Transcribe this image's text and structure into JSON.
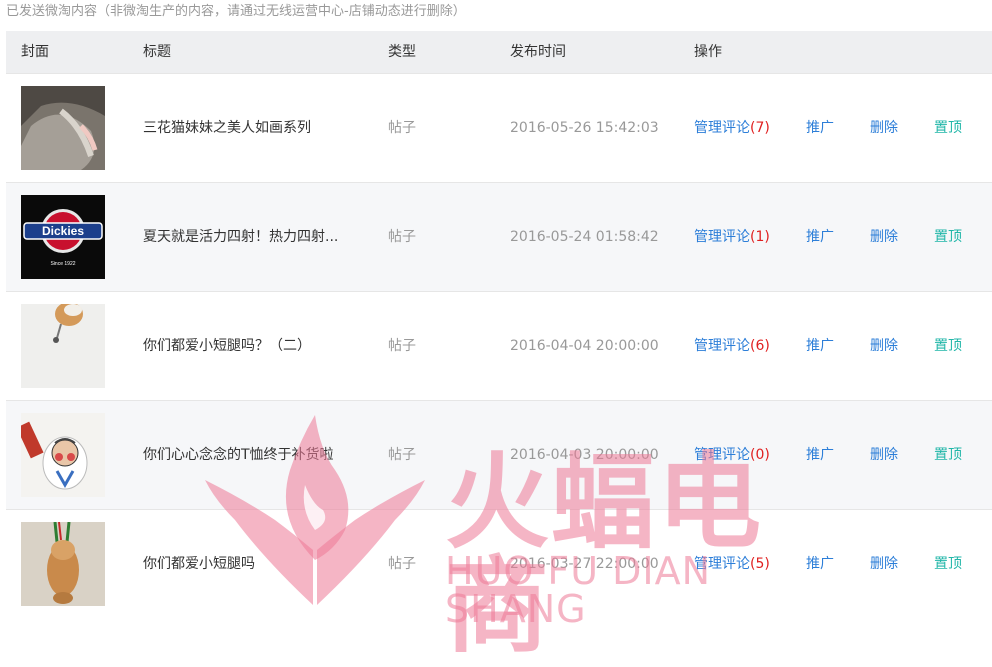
{
  "notice": "已发送微淘内容（非微淘生产的内容，请通过无线运营中心-店铺动态进行删除）",
  "columns": {
    "cover": "封面",
    "title": "标题",
    "type": "类型",
    "time": "发布时间",
    "actions": "操作"
  },
  "rows": [
    {
      "title": "三花猫妹妹之美人如画系列",
      "type": "帖子",
      "time": "2016-05-26 15:42:03",
      "manage": "管理评论",
      "count": "(7)",
      "promote": "推广",
      "delete": "删除",
      "pin": "置顶"
    },
    {
      "title": "夏天就是活力四射！热力四射...",
      "type": "帖子",
      "time": "2016-05-24 01:58:42",
      "manage": "管理评论",
      "count": "(1)",
      "promote": "推广",
      "delete": "删除",
      "pin": "置顶"
    },
    {
      "title": "你们都爱小短腿吗？（二）",
      "type": "帖子",
      "time": "2016-04-04 20:00:00",
      "manage": "管理评论",
      "count": "(6)",
      "promote": "推广",
      "delete": "删除",
      "pin": "置顶"
    },
    {
      "title": "你们心心念念的T恤终于补货啦",
      "type": "帖子",
      "time": "2016-04-03 20:00:00",
      "manage": "管理评论",
      "count": "(0)",
      "promote": "推广",
      "delete": "删除",
      "pin": "置顶"
    },
    {
      "title": "你们都爱小短腿吗",
      "type": "帖子",
      "time": "2016-03-27 22:00:00",
      "manage": "管理评论",
      "count": "(5)",
      "promote": "推广",
      "delete": "删除",
      "pin": "置顶"
    }
  ],
  "thumb_brand_text": "Dickies",
  "thumb_brand_sub": "Since 1922",
  "watermark": {
    "cn": "火蝠电商",
    "en": "HUO FU DIAN SHANG"
  }
}
